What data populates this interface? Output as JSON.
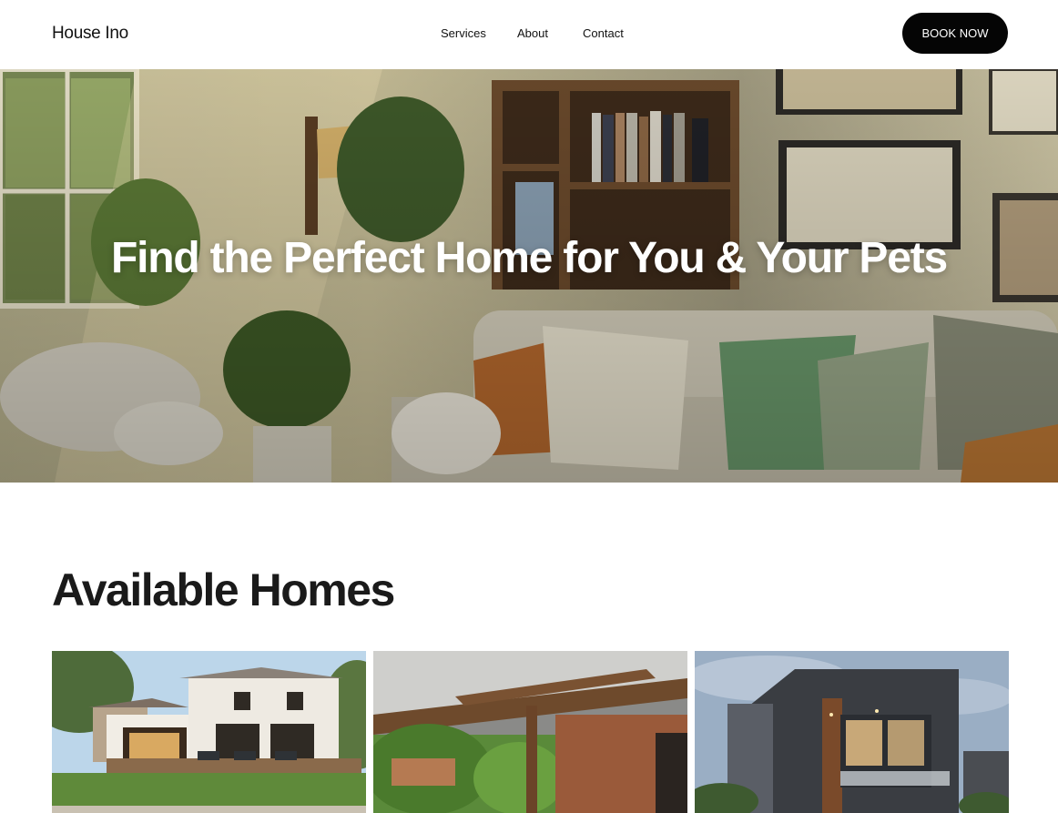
{
  "header": {
    "logo": "House Ino",
    "nav": [
      "Services",
      "About",
      "Contact"
    ],
    "cta": "BOOK NOW"
  },
  "hero": {
    "title": "Find the Perfect Home for You & Your Pets"
  },
  "available": {
    "title": "Available Homes",
    "cards": [
      {
        "image": "modern-white-house-backyard"
      },
      {
        "image": "covered-patio-garden"
      },
      {
        "image": "contemporary-dark-facade-house"
      }
    ]
  }
}
